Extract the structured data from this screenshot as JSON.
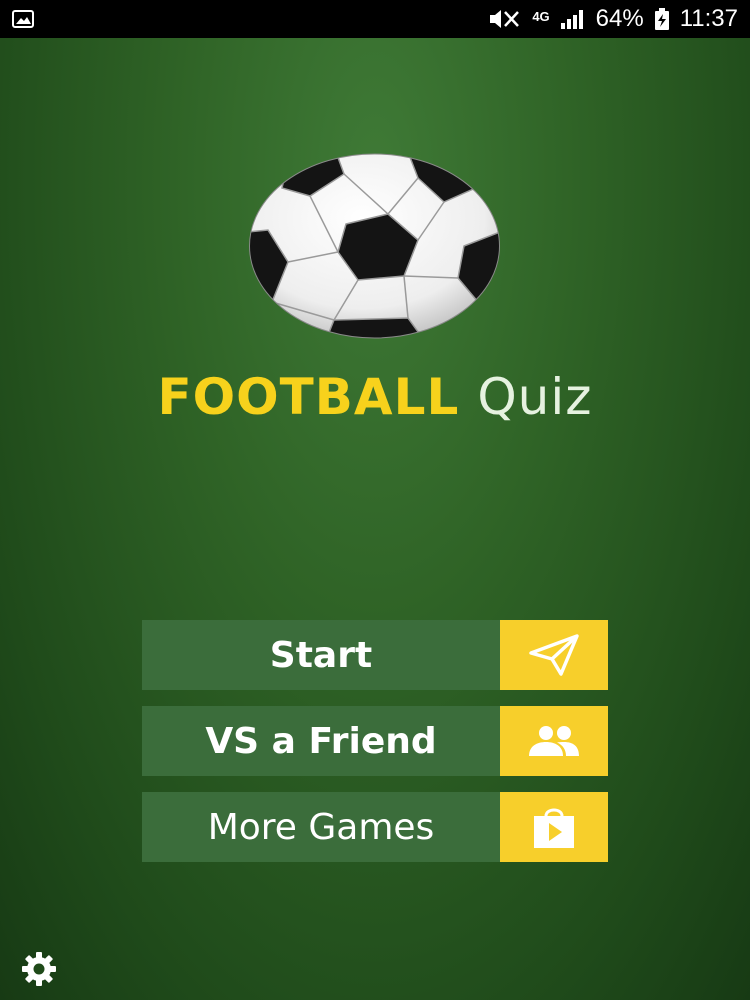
{
  "status_bar": {
    "battery": "64%",
    "time": "11:37",
    "network": "4G"
  },
  "title": {
    "word1": "FOOTBALL",
    "word2": "Quiz"
  },
  "menu": {
    "start_label": "Start",
    "vs_friend_label": "VS a Friend",
    "more_games_label": "More Games"
  },
  "colors": {
    "accent_yellow": "#f7cf2b",
    "button_green": "#3b6d3b",
    "background_green": "#2f6326"
  },
  "icons": {
    "start": "paper-plane-icon",
    "vs_friend": "people-icon",
    "more_games": "play-store-icon",
    "settings": "gear-icon"
  }
}
